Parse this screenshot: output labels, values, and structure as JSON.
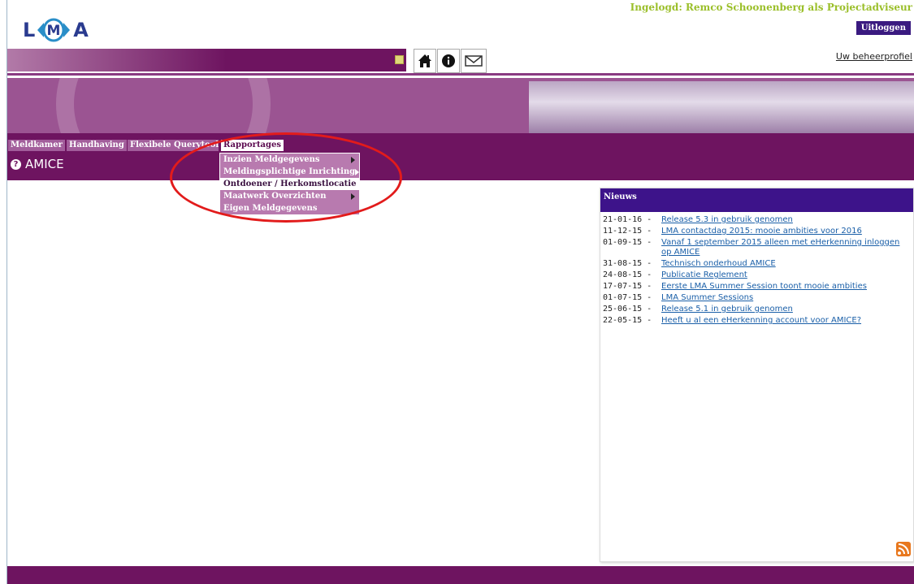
{
  "header": {
    "logo_text_left": "L",
    "logo_text_mid": "M",
    "logo_text_right": "A",
    "login_info": "Ingelogd: Remco Schoonenberg als Projectadviseur",
    "logout_label": "Uitloggen",
    "profile_link": "Uw beheerprofiel"
  },
  "toolbar": {
    "icons": [
      "home-icon",
      "info-icon",
      "mail-icon"
    ]
  },
  "nav": {
    "tabs": [
      {
        "label": "Meldkamer"
      },
      {
        "label": "Handhaving"
      },
      {
        "label": "Flexibele Querytool"
      },
      {
        "label": "Rapportages"
      }
    ],
    "dropdown": [
      {
        "label": "Inzien Meldgegevens",
        "submenu": true
      },
      {
        "label": "Meldingsplichtige Inrichting",
        "submenu": true
      },
      {
        "label": "Ontdoener / Herkomstlocatie",
        "submenu": false
      },
      {
        "label": "Maatwerk Overzichten",
        "submenu": true
      },
      {
        "label": "Eigen Meldgegevens",
        "submenu": false
      }
    ]
  },
  "page": {
    "title": "AMICE"
  },
  "news": {
    "heading": "Nieuws",
    "items": [
      {
        "date": "21-01-16 -",
        "title": "Release 5.3 in gebruik genomen"
      },
      {
        "date": "11-12-15 -",
        "title": "LMA contactdag 2015: mooie ambities voor 2016"
      },
      {
        "date": "01-09-15 -",
        "title": "Vanaf 1 september 2015 alleen met eHerkenning inloggen op AMICE"
      },
      {
        "date": "31-08-15 -",
        "title": "Technisch onderhoud AMICE"
      },
      {
        "date": "24-08-15 -",
        "title": "Publicatie Reglement"
      },
      {
        "date": "17-07-15 -",
        "title": "Eerste LMA Summer Session toont mooie ambities"
      },
      {
        "date": "01-07-15 -",
        "title": "LMA Summer Sessions"
      },
      {
        "date": "25-06-15 -",
        "title": "Release 5.1 in gebruik genomen"
      },
      {
        "date": "22-05-15 -",
        "title": "Heeft u al een eHerkenning account voor AMICE?"
      }
    ]
  },
  "colors": {
    "brand_purple": "#6e1460",
    "news_header": "#3d138a",
    "annotation_red": "#e21b1b",
    "login_green": "#9bbf2a"
  }
}
